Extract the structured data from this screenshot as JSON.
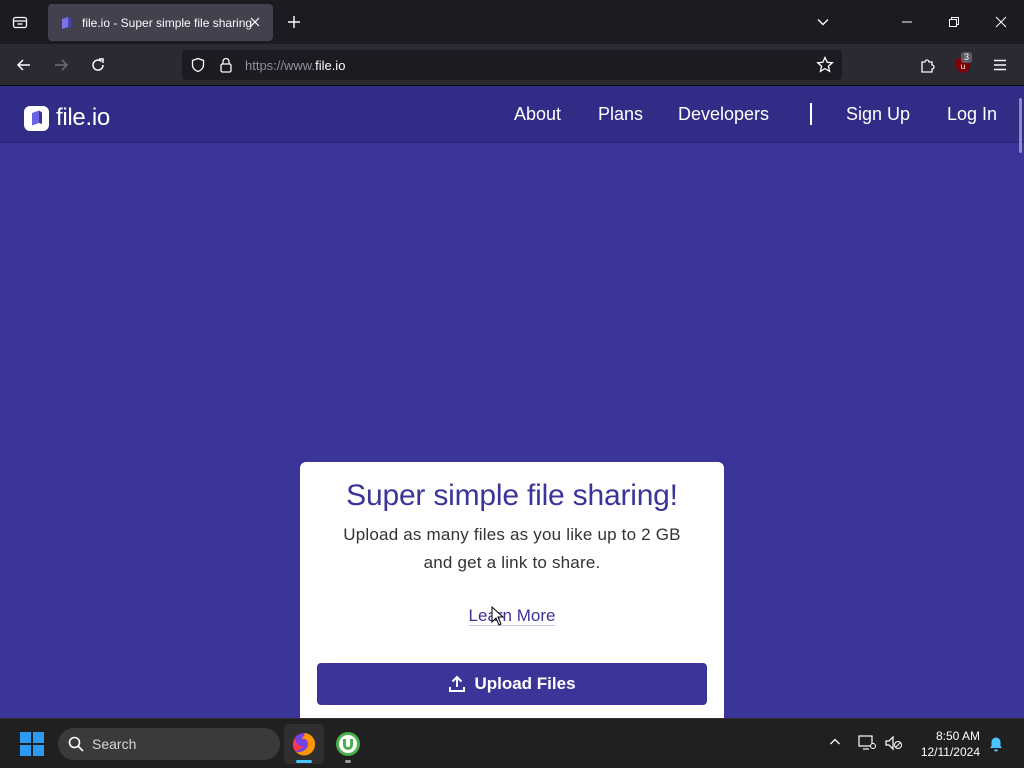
{
  "browser": {
    "tab": {
      "title": "file.io - Super simple file sharing"
    },
    "url": {
      "prefix": "https://www.",
      "host": "file.io"
    },
    "extension_badge": "3"
  },
  "site": {
    "logo_text": "file.io",
    "nav": {
      "about": "About",
      "plans": "Plans",
      "developers": "Developers",
      "signup": "Sign Up",
      "login": "Log In"
    },
    "card": {
      "heading": "Super simple file sharing!",
      "subtext_line1": "Upload as many files as you like up to 2 GB",
      "subtext_line2": "and get a link to share.",
      "learn_more": "Learn More",
      "upload_label": "Upload Files"
    },
    "colors": {
      "brand": "#3b3599",
      "header": "#312c85"
    }
  },
  "taskbar": {
    "search_placeholder": "Search",
    "time": "8:50 AM",
    "date": "12/11/2024",
    "apps": [
      "firefox-icon",
      "utorrent-icon"
    ]
  }
}
